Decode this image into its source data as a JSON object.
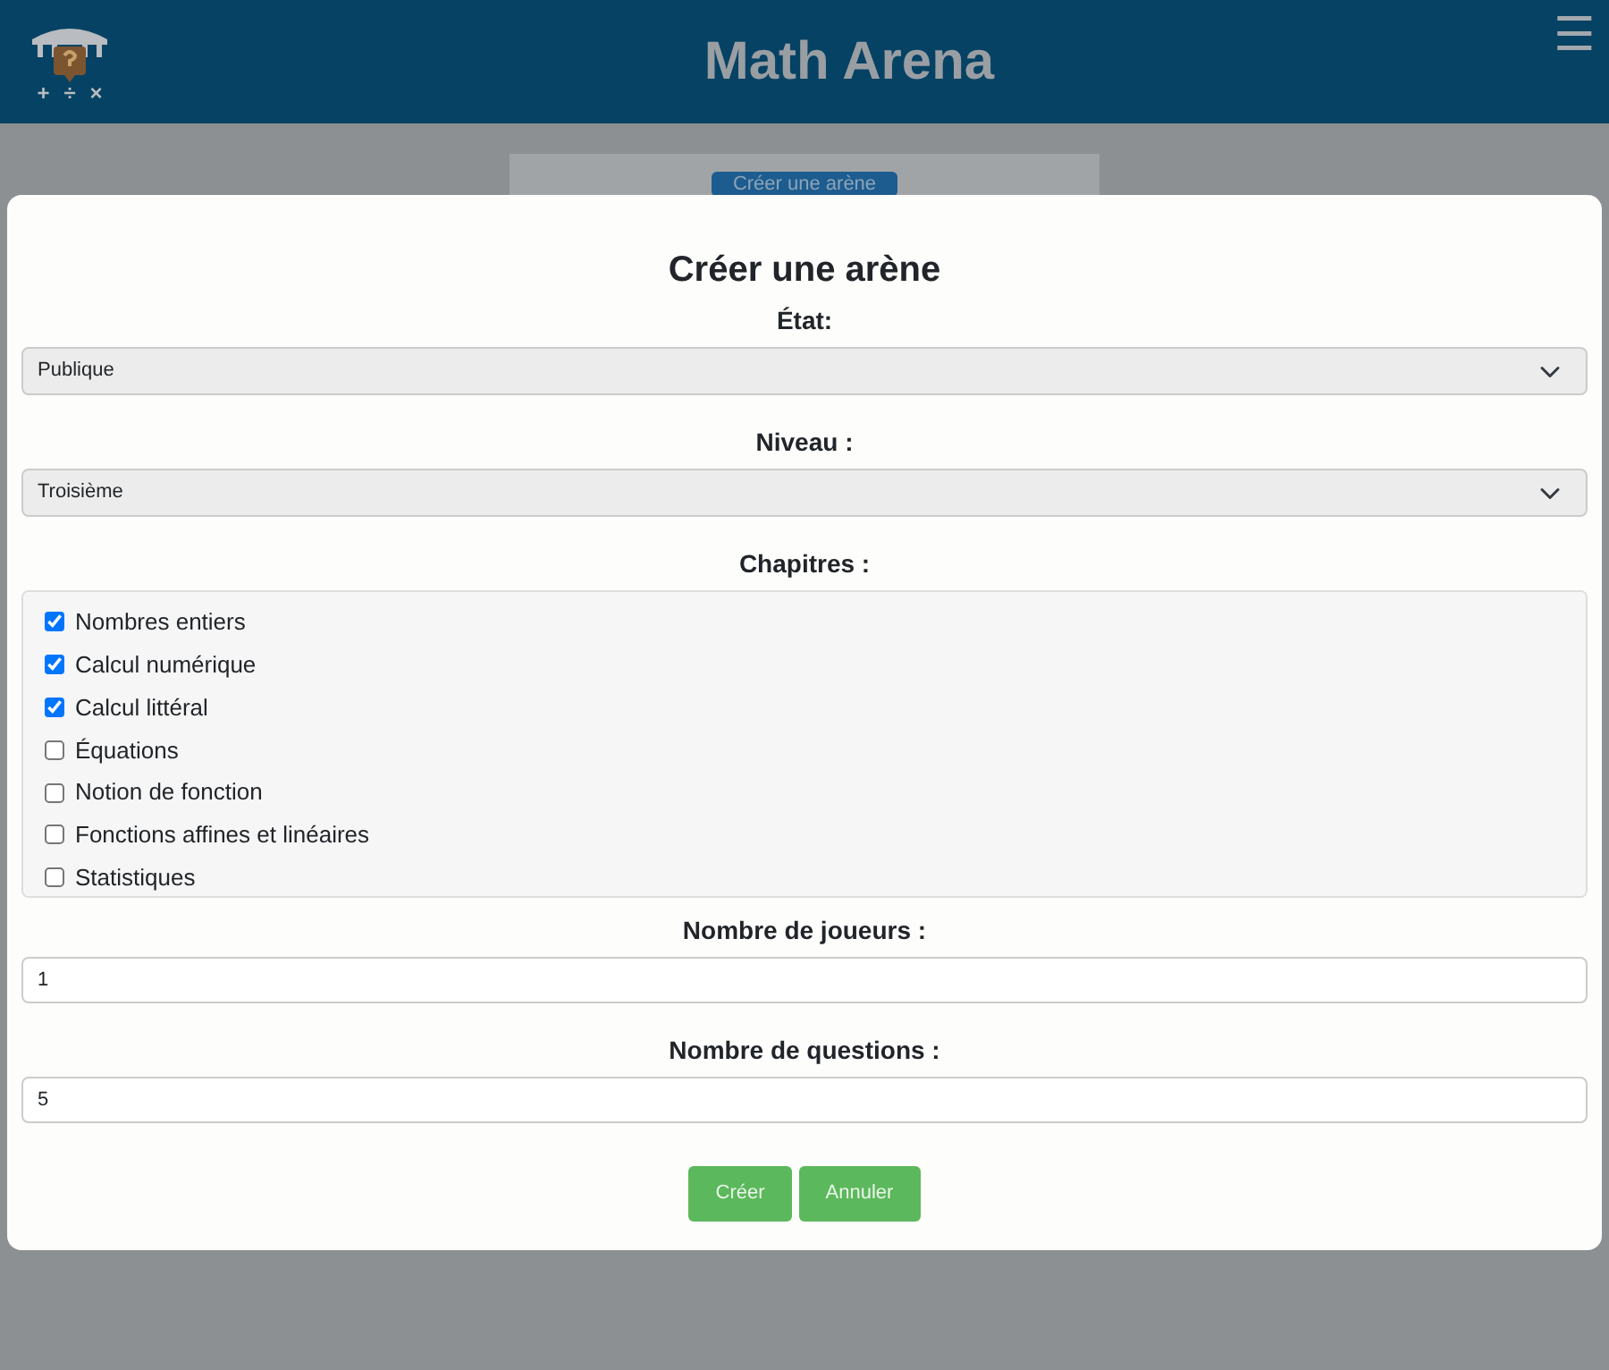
{
  "header": {
    "title": "Math Arena",
    "logo_symbols": [
      "+",
      "÷",
      "×"
    ],
    "menu_icon": "☰"
  },
  "background_button": "Créer une arène",
  "modal": {
    "title": "Créer une arène",
    "state": {
      "label": "État:",
      "value": "Publique"
    },
    "level": {
      "label": "Niveau :",
      "value": "Troisième"
    },
    "chapters": {
      "label": "Chapitres :",
      "items": [
        {
          "label": "Nombres entiers",
          "checked": true
        },
        {
          "label": "Calcul numérique",
          "checked": true
        },
        {
          "label": "Calcul littéral",
          "checked": true
        },
        {
          "label": "Équations",
          "checked": false
        },
        {
          "label": "Notion de fonction",
          "checked": false
        },
        {
          "label": "Fonctions affines et linéaires",
          "checked": false
        },
        {
          "label": "Statistiques",
          "checked": false
        }
      ]
    },
    "players": {
      "label": "Nombre de joueurs :",
      "value": "1"
    },
    "questions": {
      "label": "Nombre de questions :",
      "value": "5"
    },
    "buttons": [
      "Créer",
      "Annuler"
    ]
  }
}
